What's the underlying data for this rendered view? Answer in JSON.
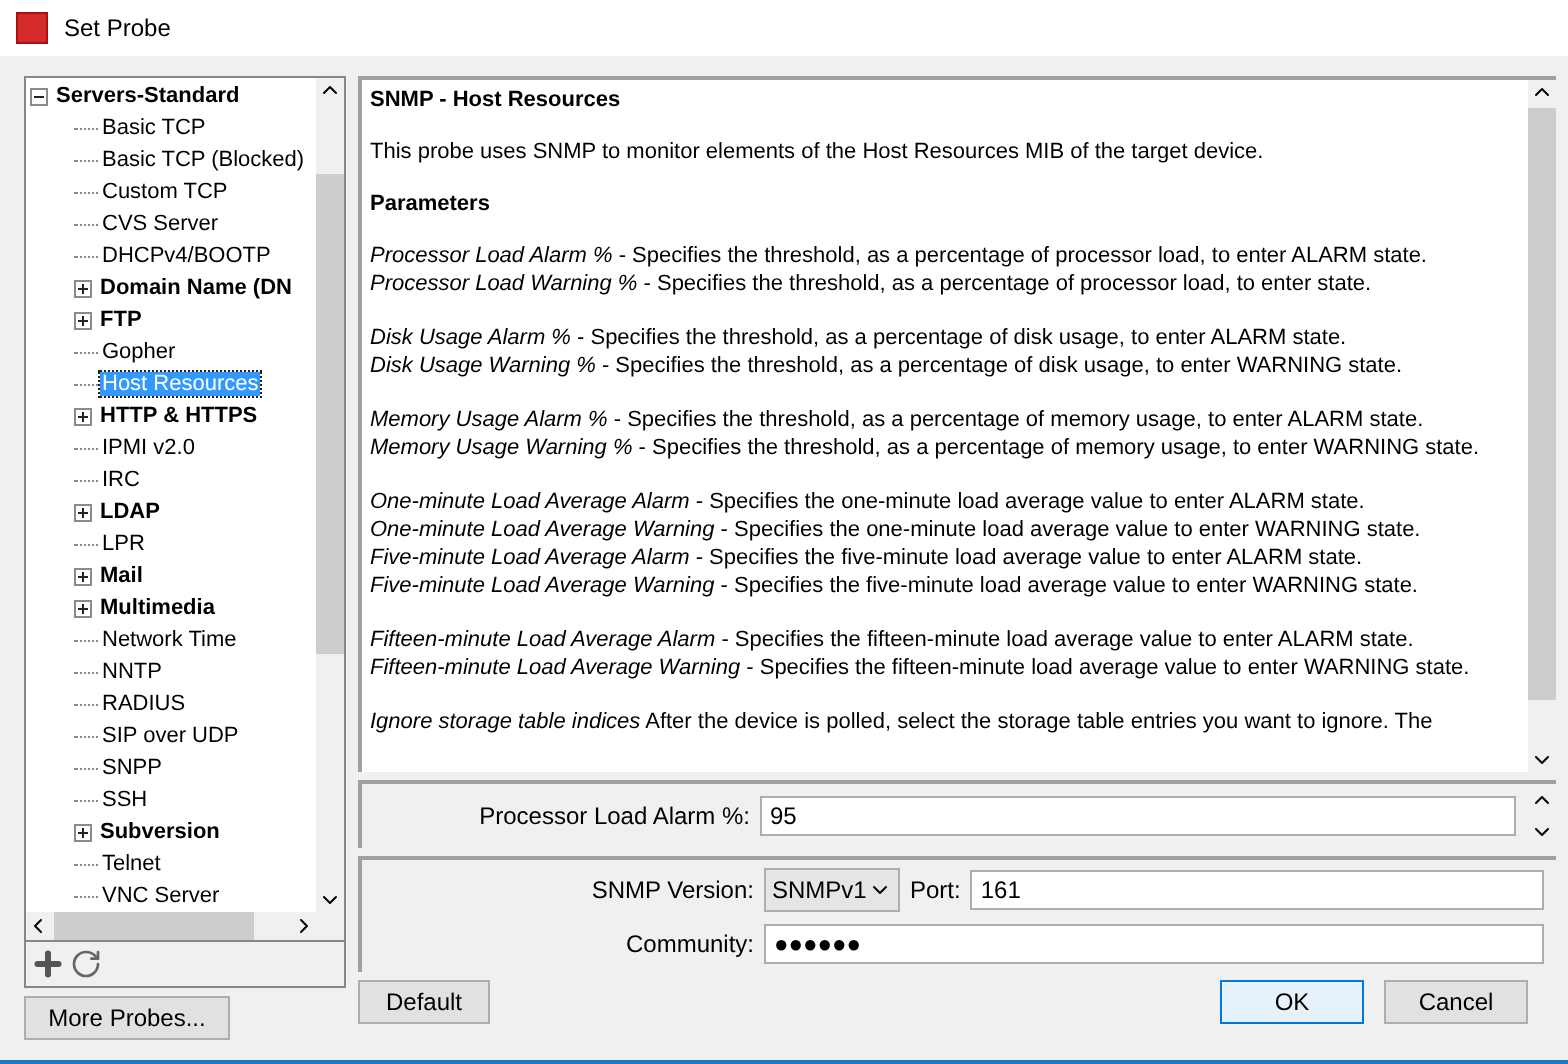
{
  "window": {
    "title": "Set Probe"
  },
  "tree": {
    "label": "Servers-Standard",
    "expanded": true,
    "selected": false,
    "children": [
      {
        "label": "Basic TCP",
        "kind": "probe",
        "selected": false
      },
      {
        "label": "Basic TCP (Blocked)",
        "kind": "probe",
        "selected": false
      },
      {
        "label": "Custom TCP",
        "kind": "probe",
        "selected": false
      },
      {
        "label": "CVS Server",
        "kind": "probe",
        "selected": false
      },
      {
        "label": "DHCPv4/BOOTP",
        "kind": "probe",
        "selected": false
      },
      {
        "label": "Domain Name (DN",
        "kind": "group",
        "expanded": false,
        "selected": false
      },
      {
        "label": "FTP",
        "kind": "group",
        "expanded": false,
        "selected": false
      },
      {
        "label": "Gopher",
        "kind": "probe",
        "selected": false
      },
      {
        "label": "Host Resources",
        "kind": "probe",
        "selected": true
      },
      {
        "label": "HTTP & HTTPS",
        "kind": "group",
        "expanded": false,
        "selected": false
      },
      {
        "label": "IPMI v2.0",
        "kind": "probe",
        "selected": false
      },
      {
        "label": "IRC",
        "kind": "probe",
        "selected": false
      },
      {
        "label": "LDAP",
        "kind": "group",
        "expanded": false,
        "selected": false
      },
      {
        "label": "LPR",
        "kind": "probe",
        "selected": false
      },
      {
        "label": "Mail",
        "kind": "group",
        "expanded": false,
        "selected": false
      },
      {
        "label": "Multimedia",
        "kind": "group",
        "expanded": false,
        "selected": false
      },
      {
        "label": "Network Time",
        "kind": "probe",
        "selected": false
      },
      {
        "label": "NNTP",
        "kind": "probe",
        "selected": false
      },
      {
        "label": "RADIUS",
        "kind": "probe",
        "selected": false
      },
      {
        "label": "SIP over UDP",
        "kind": "probe",
        "selected": false
      },
      {
        "label": "SNPP",
        "kind": "probe",
        "selected": false
      },
      {
        "label": "SSH",
        "kind": "probe",
        "selected": false
      },
      {
        "label": "Subversion",
        "kind": "group",
        "expanded": false,
        "selected": false
      },
      {
        "label": "Telnet",
        "kind": "probe",
        "selected": false
      },
      {
        "label": "VNC Server",
        "kind": "probe",
        "selected": false
      }
    ]
  },
  "more_probes_button": "More Probes...",
  "description": {
    "title": "SNMP - Host Resources",
    "intro": "This probe uses SNMP to monitor elements of the Host Resources MIB of the target device.",
    "heading": "Parameters",
    "paragraphs": [
      [
        "*Processor Load Alarm %* - Specifies the threshold, as a percentage of processor load, to enter ALARM state.",
        "*Processor Load Warning %* - Specifies the threshold, as a percentage of processor load, to enter state."
      ],
      [
        "*Disk Usage Alarm %* - Specifies the threshold, as a percentage of disk usage, to enter ALARM state.",
        "*Disk Usage Warning %* - Specifies the threshold, as a percentage of disk usage, to enter WARNING state."
      ],
      [
        "*Memory Usage Alarm %* - Specifies the threshold, as a percentage of memory usage, to enter ALARM state.",
        "*Memory Usage Warning %* - Specifies the threshold, as a percentage of memory usage, to enter WARNING state."
      ],
      [
        "*One-minute Load Average Alarm* - Specifies the one-minute load average value to enter ALARM state.",
        "*One-minute Load Average Warning* - Specifies the one-minute load average value to enter WARNING state.",
        "*Five-minute Load Average Alarm* - Specifies the five-minute load average value to enter ALARM state.",
        "*Five-minute Load Average Warning* - Specifies the five-minute load average value to enter WARNING state."
      ],
      [
        "*Fifteen-minute Load Average Alarm* - Specifies the fifteen-minute load average value to enter ALARM state.",
        "*Fifteen-minute Load Average Warning* - Specifies the fifteen-minute load average value to enter WARNING state."
      ],
      [
        "*Ignore storage table indices*  After the device is polled, select the storage table entries you want to ignore. The"
      ]
    ]
  },
  "parameter": {
    "label": "Processor Load Alarm %:",
    "value": "95"
  },
  "snmp": {
    "version_label": "SNMP Version:",
    "version": "SNMPv1",
    "port_label": "Port:",
    "port": "161",
    "community_label": "Community:",
    "community": "●●●●●●"
  },
  "buttons": {
    "default": "Default",
    "ok": "OK",
    "cancel": "Cancel"
  }
}
